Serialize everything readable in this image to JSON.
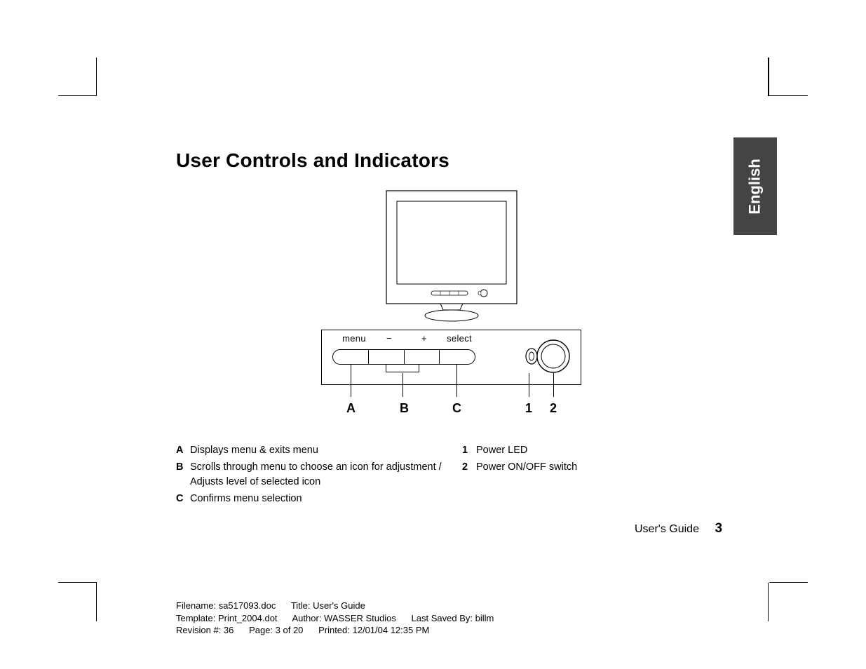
{
  "language_tab": "English",
  "heading": "User Controls and Indicators",
  "panel": {
    "labels": [
      "menu",
      "−",
      "+",
      "select"
    ]
  },
  "callouts": {
    "A": "A",
    "B": "B",
    "C": "C",
    "n1": "1",
    "n2": "2"
  },
  "legend_left": [
    {
      "key": "A",
      "desc": "Displays menu & exits menu"
    },
    {
      "key": "B",
      "desc": "Scrolls through menu to choose an icon for adjustment / Adjusts level of selected icon"
    },
    {
      "key": "C",
      "desc": "Confirms menu selection"
    }
  ],
  "legend_right": [
    {
      "key": "1",
      "desc": "Power LED"
    },
    {
      "key": "2",
      "desc": "Power ON/OFF switch"
    }
  ],
  "footer": {
    "guide": "User's Guide",
    "page": "3"
  },
  "docmeta": {
    "line1_a": "Filename: sa517093.doc",
    "line1_b": "Title: User's Guide",
    "line2_a": "Template: Print_2004.dot",
    "line2_b": "Author: WASSER Studios",
    "line2_c": "Last Saved By: billm",
    "line3_a": "Revision #: 36",
    "line3_b": "Page: 3 of 20",
    "line3_c": "Printed: 12/01/04 12:35 PM"
  }
}
